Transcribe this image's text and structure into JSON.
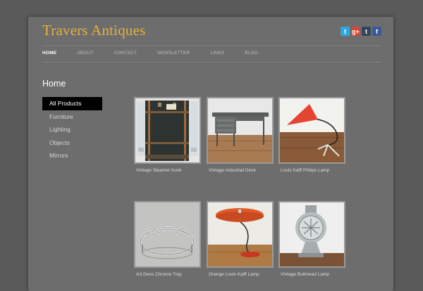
{
  "site": {
    "title": "Travers Antiques"
  },
  "social": [
    {
      "icon": "twitter-icon",
      "glyph": "t",
      "color": "#2aa9e0"
    },
    {
      "icon": "google-plus-icon",
      "glyph": "g+",
      "color": "#d14836"
    },
    {
      "icon": "tumblr-icon",
      "glyph": "t",
      "color": "#35465c"
    },
    {
      "icon": "facebook-icon",
      "glyph": "f",
      "color": "#3b5998"
    }
  ],
  "nav": [
    {
      "label": "HOME",
      "active": true
    },
    {
      "label": "ABOUT"
    },
    {
      "label": "CONTACT"
    },
    {
      "label": "NEWSLETTER"
    },
    {
      "label": "LINKS"
    },
    {
      "label": "BLOG"
    }
  ],
  "page": {
    "heading": "Home"
  },
  "sidebar": {
    "items": [
      {
        "label": "All Products",
        "active": true
      },
      {
        "label": "Furniture"
      },
      {
        "label": "Lighting"
      },
      {
        "label": "Objects"
      },
      {
        "label": "Mirrors"
      }
    ]
  },
  "products": [
    {
      "caption": "Vintage Steamer trunk",
      "image": "steamer-trunk"
    },
    {
      "caption": "Vintage Industrial Desk",
      "image": "industrial-desk"
    },
    {
      "caption": "Louis Kalff Philips Lamp",
      "image": "red-desk-lamp"
    },
    {
      "caption": "Art Deco Chrome Tray",
      "image": "chrome-tray"
    },
    {
      "caption": "Orange Louis Kalff Lamp",
      "image": "orange-lamp"
    },
    {
      "caption": "Vintage Bulkhead Lamp",
      "image": "bulkhead-lamp"
    }
  ],
  "colors": {
    "accent": "#e3b23c",
    "background": "#5a5a5a",
    "panel": "#6d6d6d"
  }
}
